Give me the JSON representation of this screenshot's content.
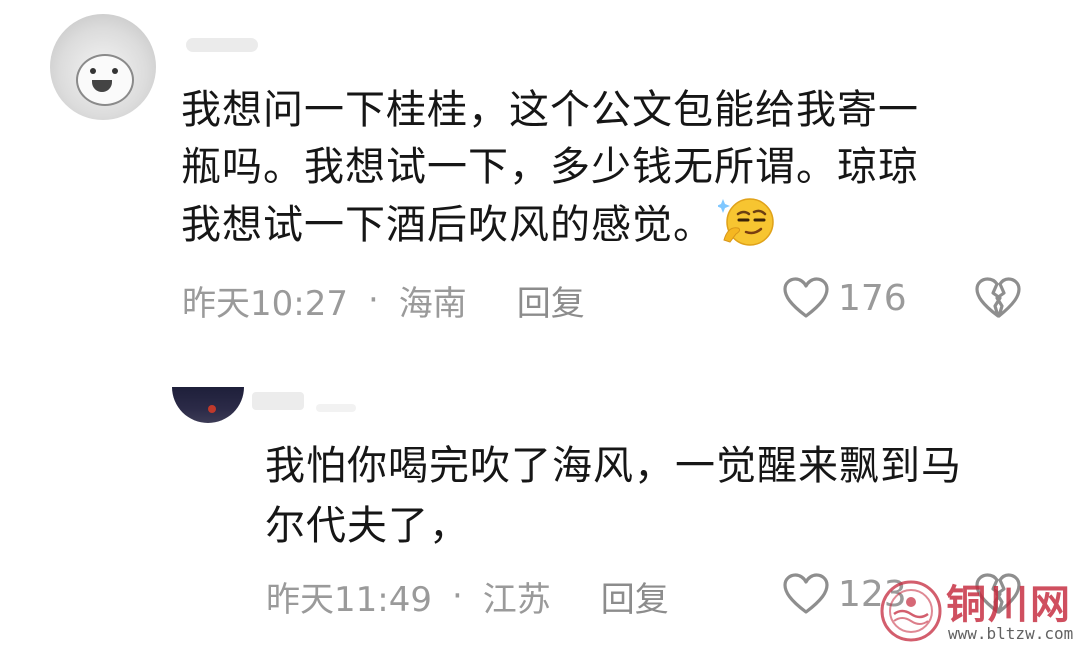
{
  "comments": [
    {
      "text_line1": "我想问一下桂桂，这个公文包能给我寄一",
      "text_line2": "瓶吗。我想试一下，多少钱无所谓。琼琼",
      "text_line3": "我想试一下酒后吹风的感觉。",
      "emoji": "smirk-thinking-emoji",
      "time": "昨天10:27",
      "separator": "·",
      "location": "海南",
      "reply_label": "回复",
      "like_count": "176",
      "like_icon": "heart-outline-icon",
      "dislike_icon": "broken-heart-icon"
    },
    {
      "text_line1": "我怕你喝完吹了海风，一觉醒来飘到马",
      "text_line2": "尔代夫了，",
      "time": "昨天11:49",
      "separator": "·",
      "location": "江苏",
      "reply_label": "回复",
      "like_count": "123",
      "like_icon": "heart-outline-icon",
      "dislike_icon": "broken-heart-icon"
    }
  ],
  "watermark": {
    "title": "铜川网",
    "url": "www.bltzw.com"
  },
  "colors": {
    "text": "#161616",
    "meta": "#9a9a9a",
    "watermark": "#c4283c"
  }
}
